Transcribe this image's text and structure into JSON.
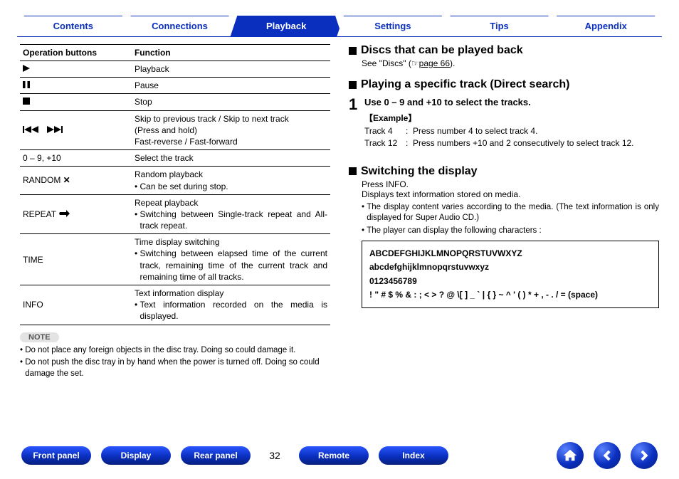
{
  "tabs": [
    "Contents",
    "Connections",
    "Playback",
    "Settings",
    "Tips",
    "Appendix"
  ],
  "active_tab_index": 2,
  "table": {
    "headers": [
      "Operation buttons",
      "Function"
    ],
    "rows": [
      {
        "btn_icon": "play",
        "btn_text": "",
        "fn": "Playback"
      },
      {
        "btn_icon": "pause",
        "btn_text": "",
        "fn": "Pause"
      },
      {
        "btn_icon": "stop",
        "btn_text": "",
        "fn": "Stop"
      },
      {
        "btn_icon": "skip",
        "btn_text": "",
        "fn_lines": [
          "Skip to previous track / Skip to next track",
          "(Press and hold)",
          "Fast-reverse / Fast-forward"
        ]
      },
      {
        "btn_icon": "",
        "btn_text": "0 – 9, +10",
        "fn": "Select the track"
      },
      {
        "btn_icon": "shuffle",
        "btn_text": "RANDOM ",
        "fn_lines": [
          "Random playback"
        ],
        "fn_bullets": [
          "Can be set during stop."
        ]
      },
      {
        "btn_icon": "repeat",
        "btn_text": "REPEAT ",
        "fn_lines": [
          "Repeat playback"
        ],
        "fn_bullets": [
          "Switching between Single-track repeat and All-track repeat."
        ]
      },
      {
        "btn_icon": "",
        "btn_text": "TIME",
        "fn_lines": [
          "Time display switching"
        ],
        "fn_bullets": [
          "Switching between elapsed time of the current track, remaining time of the current track and remaining time of all tracks."
        ]
      },
      {
        "btn_icon": "",
        "btn_text": "INFO",
        "fn_lines": [
          "Text information display"
        ],
        "fn_bullets": [
          "Text information recorded on the media is displayed."
        ]
      }
    ]
  },
  "note_label": "NOTE",
  "notes": [
    "Do not place any foreign objects in the disc tray. Doing so could damage it.",
    "Do not push the disc tray in by hand when the power is turned off. Doing so could damage the set."
  ],
  "right": {
    "s1": {
      "title": "Discs that can be played back",
      "see_prefix": "See \"Discs\" (",
      "see_link": "page 66",
      "see_suffix": ")."
    },
    "s2": {
      "title": "Playing a specific track (Direct search)",
      "step_num": "1",
      "step_title": "Use 0 – 9 and +10 to select the tracks.",
      "example_label": "【Example】",
      "examples": [
        {
          "k": "Track 4",
          "v": "Press number 4 to select track 4."
        },
        {
          "k": "Track 12",
          "v": "Press numbers +10 and 2 consecutively to select track 12."
        }
      ]
    },
    "s3": {
      "title": "Switching the display",
      "line1": "Press INFO.",
      "line2": "Displays text information stored on media.",
      "bullets": [
        "The display content varies according to the media. (The text information is only displayed for Super Audio CD.)",
        "The player can display the following characters :"
      ],
      "chars": [
        "ABCDEFGHIJKLMNOPQRSTUVWXYZ",
        "abcdefghijklmnopqrstuvwxyz",
        "0123456789",
        "! \" # $ % & : ; < > ? @ \\[ ] _ ` | { } ~ ^ ' ( ) * + , - . / = (space)"
      ]
    }
  },
  "footer": {
    "buttons_left": [
      "Front panel",
      "Display",
      "Rear panel"
    ],
    "page": "32",
    "buttons_right": [
      "Remote",
      "Index"
    ]
  }
}
